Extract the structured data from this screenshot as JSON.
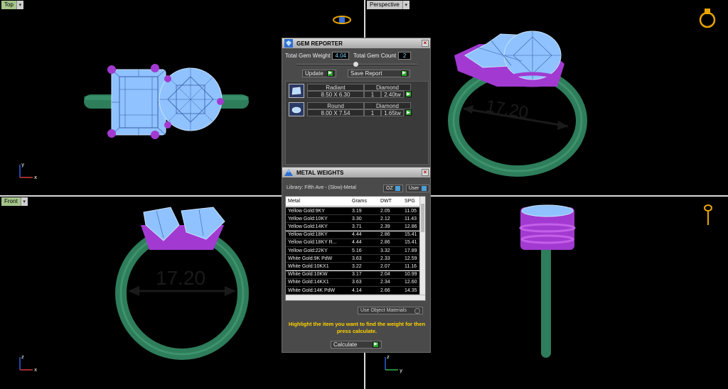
{
  "viewports": {
    "top": {
      "label": "Top",
      "dimension": ""
    },
    "perspective": {
      "label": "Perspective",
      "dimension": "17.20"
    },
    "front": {
      "label": "Front",
      "dimension": "17.20"
    },
    "right": {
      "label": "",
      "dimension": ""
    }
  },
  "axes": {
    "top": [
      "y",
      "x"
    ],
    "front": [
      "z",
      "x"
    ],
    "right": [
      "z",
      "y"
    ]
  },
  "gem_reporter": {
    "title": "GEM REPORTER",
    "total_weight_label": "Total Gem Weight",
    "total_weight_value": "4.04",
    "total_count_label": "Total Gem Count",
    "total_count_value": "2",
    "update_label": "Update",
    "save_report_label": "Save Report",
    "gems": [
      {
        "shape": "Radiant",
        "size": "8.50 X 6.30",
        "type": "Diamond",
        "qty": "1",
        "weight": "2.40tw"
      },
      {
        "shape": "Round",
        "size": "8.00 X 7.54",
        "type": "Diamond",
        "qty": "1",
        "weight": "1.65tw"
      }
    ]
  },
  "metal_weights": {
    "title": "METAL WEIGHTS",
    "library_label": "Library: Fifth Ave - (Slow)-Metal",
    "oz_label": "OZ",
    "user_label": "User",
    "columns": [
      "Metal",
      "Grams",
      "DWT",
      "SPG"
    ],
    "rows": [
      [
        "Yellow Gold:9KY",
        "3.19",
        "2.05",
        "11.05"
      ],
      [
        "Yellow Gold:10KY",
        "3.30",
        "2.12",
        "11.43"
      ],
      [
        "Yellow Gold:14KY",
        "3.71",
        "2.39",
        "12.86"
      ],
      [
        "Yellow Gold:18KY",
        "4.44",
        "2.86",
        "15.41"
      ],
      [
        "Yellow Gold:18KY R...",
        "4.44",
        "2.86",
        "15.41"
      ],
      [
        "Yellow Gold:22KY",
        "5.16",
        "3.32",
        "17.89"
      ],
      [
        "White Gold:9K PdW",
        "3.63",
        "2.33",
        "12.59"
      ],
      [
        "White Gold:10KX1",
        "3.22",
        "2.07",
        "11.16"
      ],
      [
        "White Gold:10KW",
        "3.17",
        "2.04",
        "10.99"
      ],
      [
        "White Gold:14KX1",
        "3.63",
        "2.34",
        "12.60"
      ],
      [
        "White Gold:14K PdW",
        "4.14",
        "2.66",
        "14.35"
      ]
    ],
    "use_object_materials": "Use Object Materials",
    "hint": "Highlight the item you want to find the weight for then press calculate.",
    "calculate_label": "Calculate"
  },
  "colors": {
    "band": "#2e7d5b",
    "prong": "#a23ad1",
    "gem": "#8fc2ff",
    "dimension_arrow": "#1a1a1a",
    "panel_bg": "#4a4a4a",
    "hint_text": "#ffd200"
  },
  "icons": [
    "ring-nav-icon",
    "close-icon",
    "gem-icon",
    "metal-weights-icon",
    "play-icon"
  ]
}
